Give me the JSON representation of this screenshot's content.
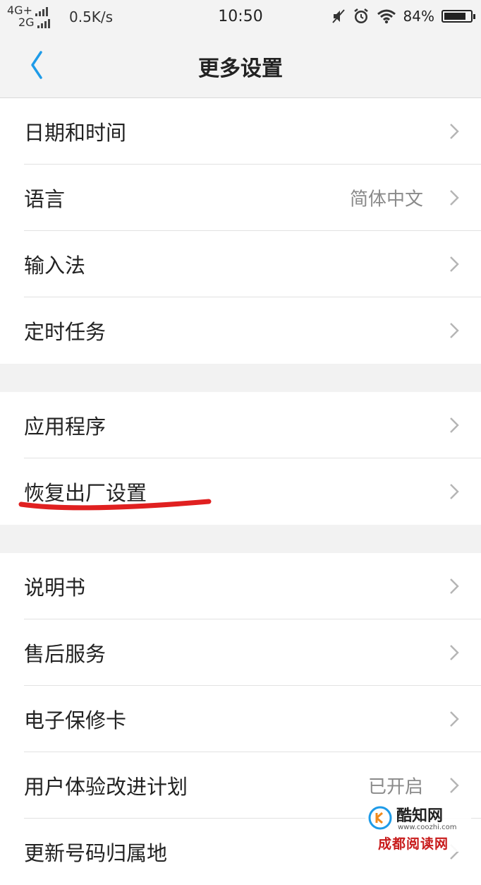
{
  "status_bar": {
    "network_top": "4G+",
    "network_bottom": "2G",
    "speed": "0.5K/s",
    "time": "10:50",
    "battery": "84%",
    "battery_level": 0.84,
    "icons": [
      "signal-icon",
      "mute-icon",
      "alarm-icon",
      "wifi-icon",
      "battery-icon"
    ]
  },
  "nav": {
    "title": "更多设置",
    "back_icon": "chevron-left-icon"
  },
  "groups": [
    {
      "items": [
        {
          "label": "日期和时间",
          "value": ""
        },
        {
          "label": "语言",
          "value": "简体中文"
        },
        {
          "label": "输入法",
          "value": ""
        },
        {
          "label": "定时任务",
          "value": ""
        }
      ]
    },
    {
      "items": [
        {
          "label": "应用程序",
          "value": ""
        },
        {
          "label": "恢复出厂设置",
          "value": ""
        }
      ]
    },
    {
      "items": [
        {
          "label": "说明书",
          "value": ""
        },
        {
          "label": "售后服务",
          "value": ""
        },
        {
          "label": "电子保修卡",
          "value": ""
        },
        {
          "label": "用户体验改进计划",
          "value": "已开启"
        },
        {
          "label": "更新号码归属地",
          "value": ""
        }
      ]
    }
  ],
  "watermarks": {
    "site_name": "酷知网",
    "site_url": "www.coozhi.com",
    "site2": "成都阅读网"
  },
  "colors": {
    "accent": "#1e9be8",
    "annotation": "#e02020",
    "chevron": "#b5b5b5"
  }
}
